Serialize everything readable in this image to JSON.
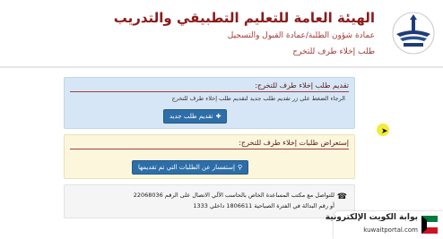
{
  "header": {
    "title": "الهيئة العامة للتعليم التطبيقي والتدريب",
    "subtitle": "عمادة شؤون الطلبة/عمادة القبول والتسجيل",
    "page_title": "طلب إخلاء طرف للتخرج"
  },
  "panel_new": {
    "title": "تقديم طلب إخلاء طرف للتخرج:",
    "instruction": "الرجاء الضغط على زر تقديم طلب جديد لتقديم طلب إخلاء طرف للتخرج",
    "button_label": "تقديم طلب جديد",
    "button_icon": "plus-icon"
  },
  "panel_review": {
    "title": "إستعراض طلبات إخلاء طرف للتخرج:",
    "button_label": "إستفسار عن الطلبات التي تم تقديمها",
    "button_icon": "search-icon"
  },
  "contact": {
    "icon": "phone-icon",
    "line1": "للتواصل مع مكتب المساعدة الخاص بالحاسب الآلي الاتصال على الرقم 22068036",
    "line2": "أو رقم البدالة في الفترة الصباحية 1806611 داخلي 1333"
  },
  "watermark": {
    "title": "بوابة الكويت الإلكترونية",
    "url": "kuwaitportal.com"
  },
  "colors": {
    "brand": "#8b1a1a",
    "button": "#2e6ea8",
    "panel_blue": "#d6e6f6",
    "panel_yellow": "#fbf6dc"
  }
}
